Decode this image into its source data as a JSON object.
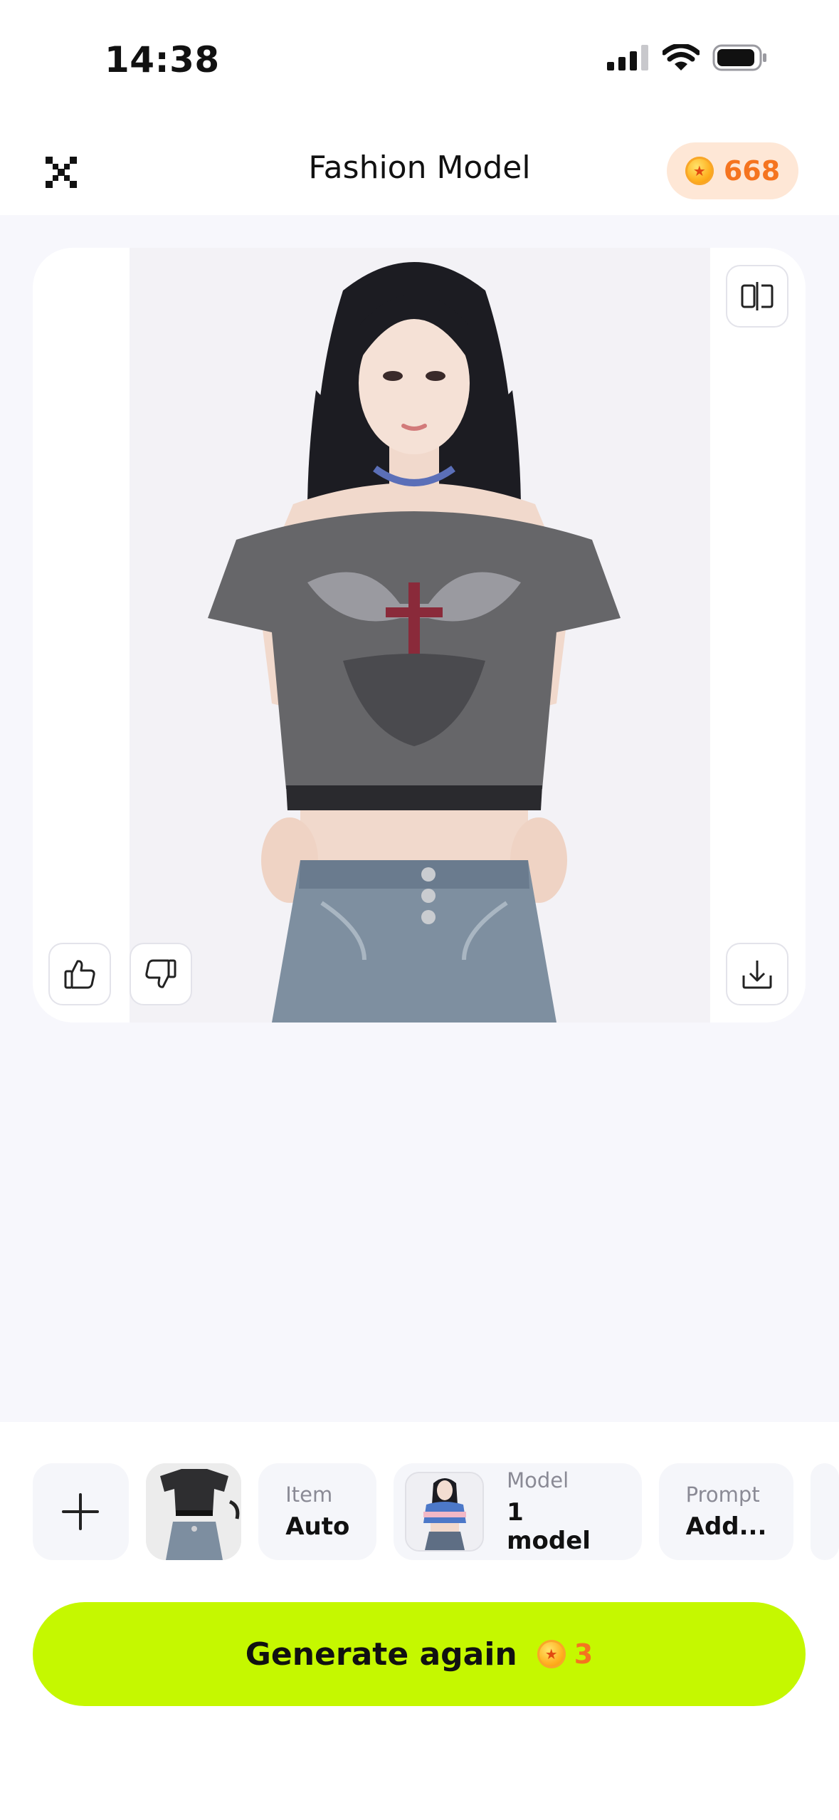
{
  "status_bar": {
    "time": "14:38"
  },
  "header": {
    "title": "Fashion Model",
    "coins": "668"
  },
  "actions": {
    "compare_icon": "compare-icon",
    "like_icon": "thumbs-up-icon",
    "dislike_icon": "thumbs-down-icon",
    "download_icon": "download-icon"
  },
  "options": {
    "item": {
      "label": "Item",
      "value": "Auto"
    },
    "model": {
      "label": "Model",
      "value": "1 model"
    },
    "prompt": {
      "label": "Prompt",
      "value": "Add..."
    }
  },
  "cta": {
    "label": "Generate again",
    "cost": "3"
  },
  "colors": {
    "accent": "#C5F800",
    "coin_text": "#F5741F",
    "coin_pill_bg": "#FEE7D6",
    "page_bg": "#F7F7FC"
  }
}
